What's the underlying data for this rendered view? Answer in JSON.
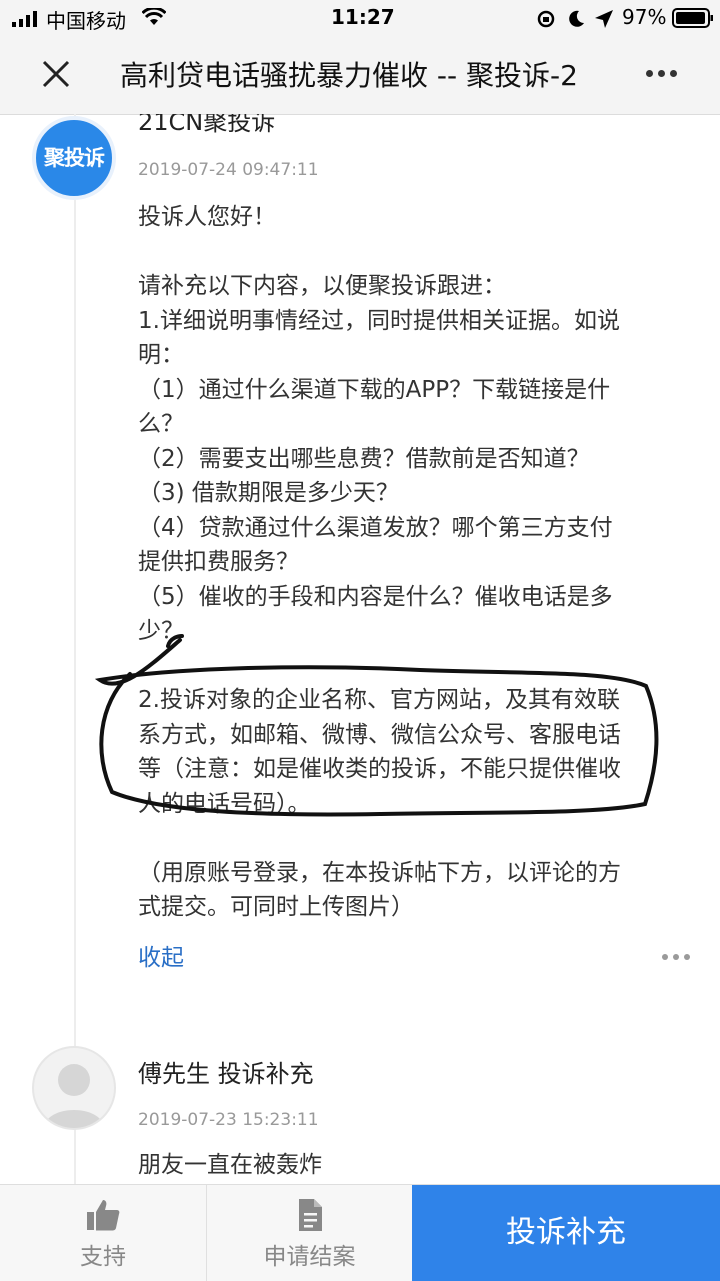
{
  "status_bar": {
    "carrier": "中国移动",
    "time": "11:27",
    "battery": "97%"
  },
  "nav": {
    "title": "高利贷电话骚扰暴力催收 -- 聚投诉-2"
  },
  "posts": [
    {
      "avatar_text": "聚投诉",
      "author": "21CN聚投诉",
      "time": "2019-07-24 09:47:11",
      "lines": [
        "投诉人您好！",
        "",
        "请补充以下内容，以便聚投诉跟进：",
        "1.详细说明事情经过，同时提供相关证据。如说",
        "明：",
        "（1）通过什么渠道下载的APP？下载链接是什",
        "么？",
        "（2）需要支出哪些息费？借款前是否知道？",
        "（3) 借款期限是多少天？",
        "（4）贷款通过什么渠道发放？哪个第三方支付",
        "提供扣费服务？",
        "（5）催收的手段和内容是什么？催收电话是多",
        "少？",
        "",
        "2.投诉对象的企业名称、官方网站，及其有效联",
        "系方式，如邮箱、微博、微信公众号、客服电话",
        "等（注意：如是催收类的投诉，不能只提供催收",
        "人的电话号码）。",
        "",
        "（用原账号登录，在本投诉帖下方，以评论的方",
        "式提交。可同时上传图片）"
      ],
      "collapse_label": "收起"
    },
    {
      "author": "傅先生 投诉补充",
      "time": "2019-07-23 15:23:11",
      "lines": [
        "朋友一直在被轰炸"
      ]
    }
  ],
  "bottom_bar": {
    "support": "支持",
    "apply_close": "申请结案",
    "supplement": "投诉补充"
  },
  "colors": {
    "accent": "#2f83e9",
    "link": "#2a6fc6",
    "brand_avatar": "#2a88e8"
  }
}
